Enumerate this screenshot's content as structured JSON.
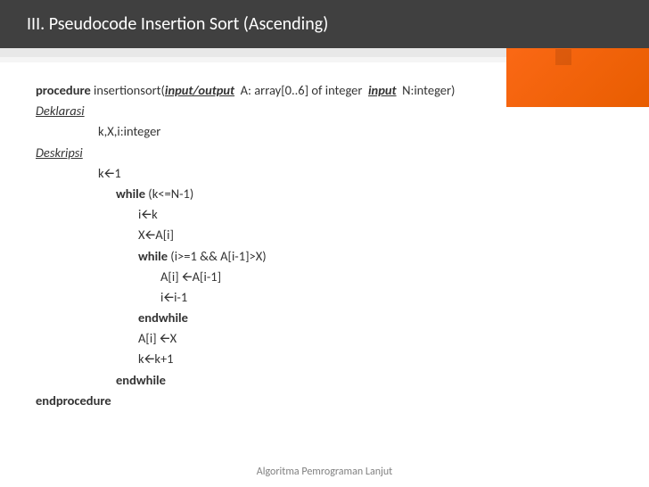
{
  "header": {
    "title": "III. Pseudocode Insertion Sort (Ascending)"
  },
  "code": {
    "line1_bold": "procedure",
    "line1_rest": " insertionsort(",
    "line1_io": "input/output",
    "line1_mid": "  A: array[0..6] of integer  ",
    "line1_input": "input",
    "line1_end": "  N:integer)",
    "line2": "Deklarasi",
    "line3": "k,X,i:integer",
    "line4": "Deskripsi",
    "line5": "k🡨1",
    "line6_bold": "while",
    "line6_rest": " (k<=N-1)",
    "line7": "i🡨k",
    "line8": "X🡨A[i]",
    "line9_bold": "while",
    "line9_rest": " (i>=1 && A[i-1]>X)",
    "line10": "A[i] 🡨A[i-1]",
    "line11": "i🡨i-1",
    "line12": "endwhile",
    "line13": "A[i] 🡨X",
    "line14": "k🡨k+1",
    "line15": "endwhile",
    "line16": "endprocedure"
  },
  "footer": {
    "text": "Algoritma Pemrograman Lanjut"
  }
}
